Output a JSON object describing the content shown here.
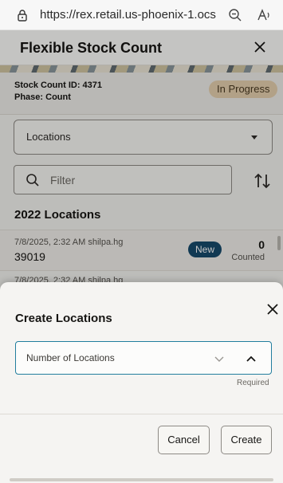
{
  "browser": {
    "url": "https://rex.retail.us-phoenix-1.ocs.o...",
    "icons": [
      "lock-icon",
      "zoom-out-icon",
      "read-aloud-icon"
    ]
  },
  "header": {
    "title": "Flexible Stock Count",
    "close_icon": "close-icon"
  },
  "info": {
    "stock_count_id": "Stock Count ID: 4371",
    "phase": "Phase: Count",
    "status": "In Progress"
  },
  "locations_select": {
    "label": "Locations"
  },
  "filter": {
    "placeholder": "Filter"
  },
  "section": {
    "title": "2022 Locations"
  },
  "list": {
    "items": [
      {
        "meta": "7/8/2025, 2:32 AM shilpa.hg",
        "number": "39019",
        "badge": "New",
        "count": "0",
        "count_label": "Counted"
      }
    ],
    "peek_meta": "7/8/2025, 2:32 AM shilpa.hg"
  },
  "sheet": {
    "title": "Create Locations",
    "field_label": "Number of Locations",
    "required_text": "Required",
    "cancel_label": "Cancel",
    "create_label": "Create"
  },
  "colors": {
    "status_badge": "#e5cfae",
    "new_badge": "#17496b",
    "focus_border": "#227e9e"
  }
}
